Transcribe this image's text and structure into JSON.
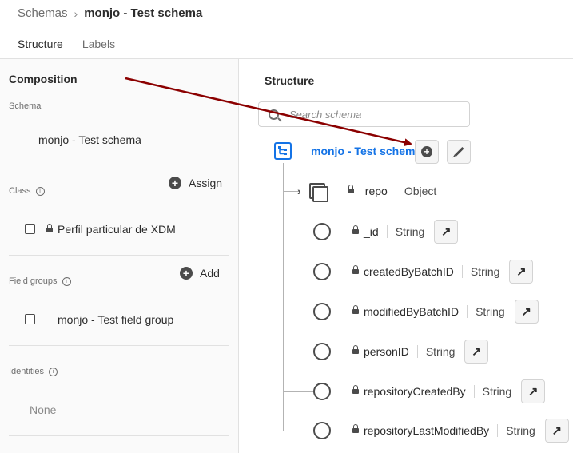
{
  "breadcrumb": {
    "parent": "Schemas",
    "separator": "›",
    "current": "monjo - Test schema"
  },
  "tabs": [
    {
      "label": "Structure",
      "active": true
    },
    {
      "label": "Labels",
      "active": false
    }
  ],
  "composition": {
    "title": "Composition",
    "schema_label": "Schema",
    "schema_value": "monjo - Test schema",
    "class_label": "Class",
    "assign_label": "Assign",
    "class_value": "Perfil particular de XDM",
    "field_groups_label": "Field groups",
    "add_label": "Add",
    "field_group_value": "monjo - Test field group",
    "identities_label": "Identities",
    "identities_value": "None"
  },
  "structure": {
    "title": "Structure",
    "search_placeholder": "Search schema",
    "root_title": "monjo - Test schema",
    "fields": [
      {
        "name": "_repo",
        "type": "Object",
        "kind": "object",
        "locked": true
      },
      {
        "name": "_id",
        "type": "String",
        "kind": "field",
        "locked": true
      },
      {
        "name": "createdByBatchID",
        "type": "String",
        "kind": "field",
        "locked": true
      },
      {
        "name": "modifiedByBatchID",
        "type": "String",
        "kind": "field",
        "locked": true
      },
      {
        "name": "personID",
        "type": "String",
        "kind": "field",
        "locked": true
      },
      {
        "name": "repositoryCreatedBy",
        "type": "String",
        "kind": "field",
        "locked": true
      },
      {
        "name": "repositoryLastModifiedBy",
        "type": "String",
        "kind": "field",
        "locked": true
      }
    ]
  },
  "icons": {
    "info": "info-icon",
    "lock": "lock-icon",
    "search": "search-icon",
    "add": "add-circle-icon",
    "edit": "pencil-icon",
    "open": "arrow-up-right-icon",
    "schema": "schema-tree-icon"
  },
  "colors": {
    "accent": "#1473e6",
    "annotation_arrow": "#8b0000"
  }
}
